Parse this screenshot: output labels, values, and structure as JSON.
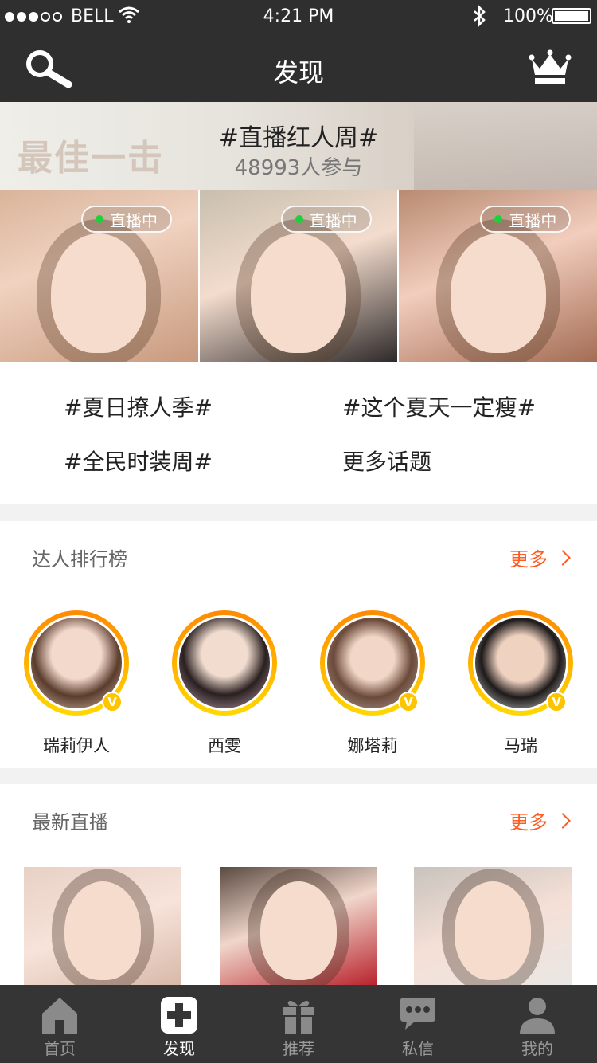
{
  "status_bar": {
    "carrier": "BELL",
    "time": "4:21 PM",
    "battery": "100%"
  },
  "nav": {
    "title": "发现"
  },
  "banner": {
    "title": "#直播红人周#",
    "participants": "48993人参与",
    "decor_text": "最佳一击"
  },
  "live_badge": "直播中",
  "topics": [
    "#夏日撩人季#",
    "#这个夏天一定瘦#",
    "#全民时装周#",
    "更多话题"
  ],
  "ranking": {
    "title": "达人排行榜",
    "more": "更多",
    "users": [
      "瑞莉伊人",
      "西雯",
      "娜塔莉",
      "马瑞"
    ],
    "verified_mark": "V"
  },
  "latest": {
    "title": "最新直播",
    "more": "更多"
  },
  "tabbar": {
    "items": [
      "首页",
      "发现",
      "推荐",
      "私信",
      "我的"
    ],
    "active": "发现"
  },
  "colors": {
    "accent": "#ff5a1f",
    "nav_bg": "#2f2f2f",
    "tab_bg": "#353535",
    "live_dot": "#1ed03a"
  }
}
